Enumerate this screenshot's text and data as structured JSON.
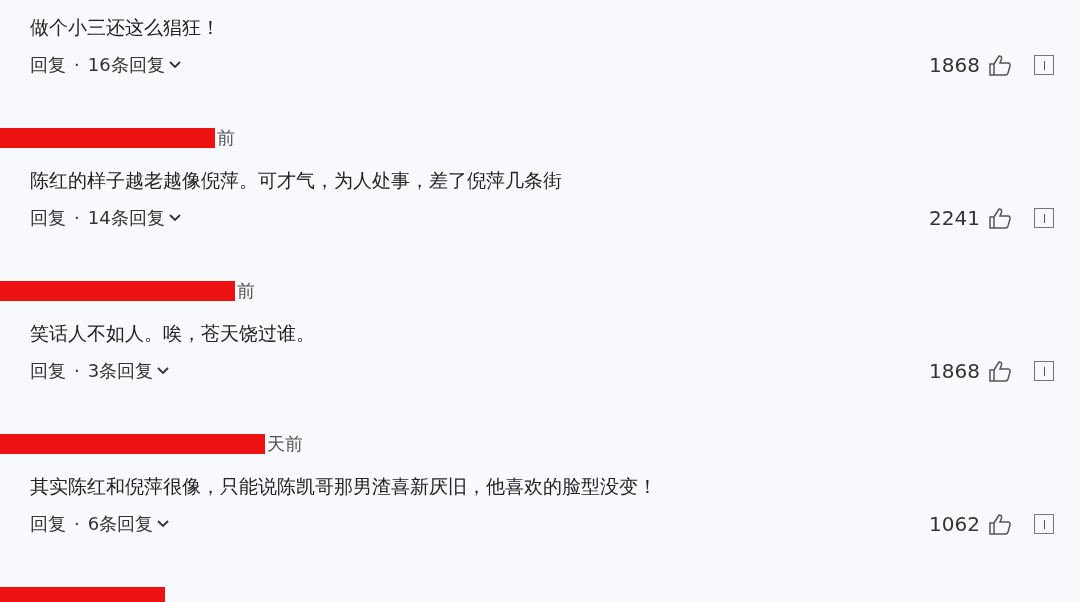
{
  "comments": [
    {
      "redacted": false,
      "text": "做个小三还这么猖狂！",
      "reply_label": "回复",
      "separator": "·",
      "replies_label": "16条回复",
      "likes": "1868"
    },
    {
      "redacted": true,
      "time": "前",
      "text": "陈红的样子越老越像倪萍。可才气，为人处事，差了倪萍几条街",
      "reply_label": "回复",
      "separator": "·",
      "replies_label": "14条回复",
      "likes": "2241"
    },
    {
      "redacted": true,
      "time": "前",
      "text": "笑话人不如人。唉，苍天饶过谁。",
      "reply_label": "回复",
      "separator": "·",
      "replies_label": "3条回复",
      "likes": "1868"
    },
    {
      "redacted": true,
      "time": "天前",
      "text": "其实陈红和倪萍很像，只能说陈凯哥那男渣喜新厌旧，他喜欢的脸型没变！",
      "reply_label": "回复",
      "separator": "·",
      "replies_label": "6条回复",
      "likes": "1062"
    },
    {
      "redacted": true
    }
  ]
}
